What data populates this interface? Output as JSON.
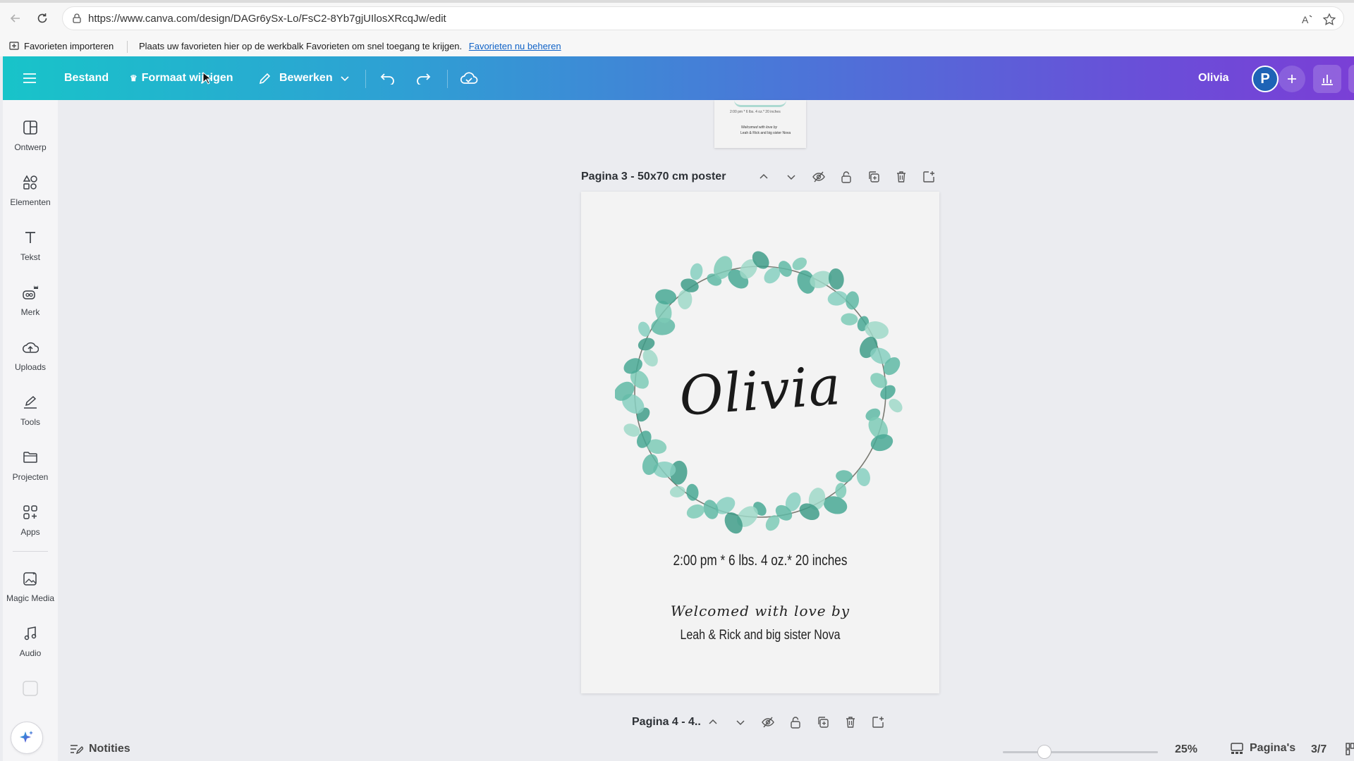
{
  "browser": {
    "url": "https://www.canva.com/design/DAGr6ySx-Lo/FsC2-8Yb7gjUIlosXRcqJw/edit"
  },
  "favorites_bar": {
    "import_label": "Favorieten importeren",
    "message": "Plaats uw favorieten hier op de werkbalk Favorieten om snel toegang te krijgen.",
    "manage_link": "Favorieten nu beheren"
  },
  "header": {
    "file_label": "Bestand",
    "resize_label": "Formaat wijzigen",
    "edit_label": "Bewerken",
    "design_title": "Olivia",
    "avatar_initial": "P",
    "gradient_colors": [
      "#18c4c9",
      "#4d73d8",
      "#7a3fd6"
    ]
  },
  "sidebar": {
    "items": [
      {
        "label": "Ontwerp",
        "icon": "layout-icon"
      },
      {
        "label": "Elementen",
        "icon": "shapes-icon"
      },
      {
        "label": "Tekst",
        "icon": "text-icon"
      },
      {
        "label": "Merk",
        "icon": "brand-icon"
      },
      {
        "label": "Uploads",
        "icon": "cloud-upload-icon"
      },
      {
        "label": "Tools",
        "icon": "pen-icon"
      },
      {
        "label": "Projecten",
        "icon": "folder-icon"
      },
      {
        "label": "Apps",
        "icon": "apps-icon"
      },
      {
        "label": "Magic Media",
        "icon": "magic-media-icon"
      },
      {
        "label": "Audio",
        "icon": "music-icon"
      }
    ]
  },
  "canvas": {
    "prev_thumb": {
      "line1": "2:00 pm * 6 lbs. 4 oz.* 20 inches",
      "line2": "Welcomed with love by",
      "line3": "Leah & Rick and big sister Nova"
    },
    "current_page_label": "Pagina 3 - 50x70 cm poster",
    "next_page_label": "Pagina 4 - 4..",
    "design": {
      "name": "Olivia",
      "stats": "2:00 pm * 6 lbs. 4 oz.* 20 inches",
      "welcome": "Welcomed with love by",
      "family": "Leah & Rick and big sister Nova"
    }
  },
  "bottom_bar": {
    "notes_label": "Notities",
    "zoom": "25%",
    "zoom_fraction": 0.25,
    "pages_label": "Pagina's",
    "page_count": "3/7"
  }
}
